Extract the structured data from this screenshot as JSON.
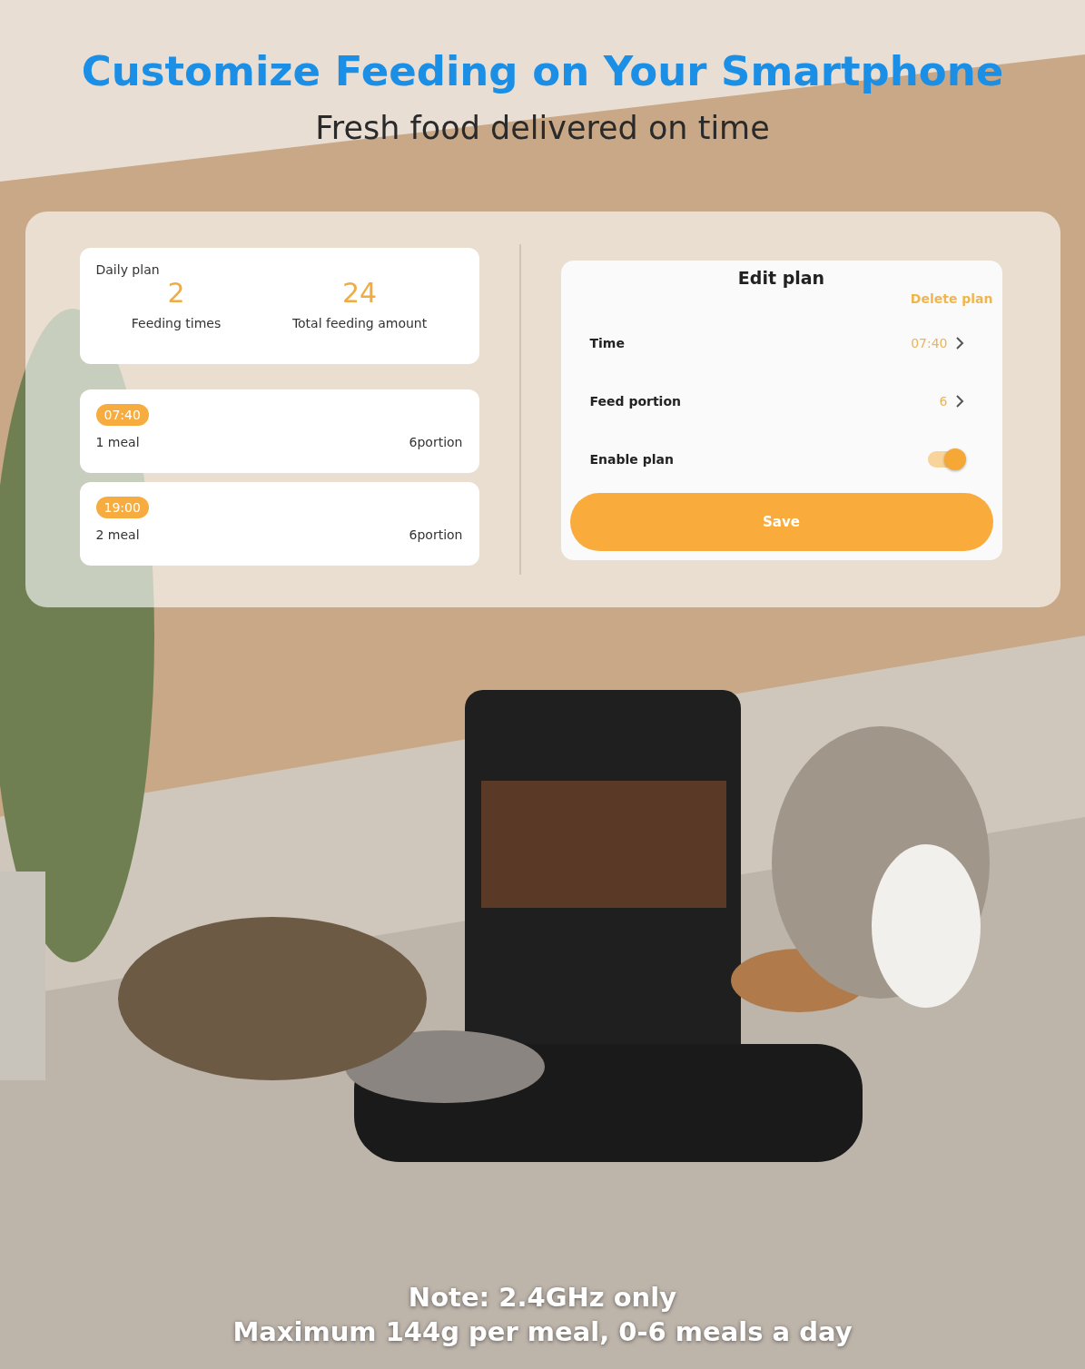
{
  "headline": "Customize Feeding on Your Smartphone",
  "subheadline": "Fresh food delivered on time",
  "daily_plan": {
    "title": "Daily plan",
    "stats": [
      {
        "value": "2",
        "label": "Feeding times"
      },
      {
        "value": "24",
        "label": "Total feeding amount"
      }
    ]
  },
  "meals": [
    {
      "time": "07:40",
      "name": "1 meal",
      "portion": "6portion"
    },
    {
      "time": "19:00",
      "name": "2 meal",
      "portion": "6portion"
    }
  ],
  "edit_plan": {
    "title": "Edit plan",
    "delete": "Delete plan",
    "rows": [
      {
        "kind": "link",
        "label": "Time",
        "value": "07:40"
      },
      {
        "kind": "link",
        "label": "Feed portion",
        "value": "6"
      },
      {
        "kind": "toggle",
        "label": "Enable plan",
        "on": true
      }
    ],
    "save": "Save"
  },
  "background": {
    "kind": "picture"
  },
  "notes": [
    "Note: 2.4GHz only",
    "Maximum 144g per meal, 0-6 meals a day"
  ]
}
